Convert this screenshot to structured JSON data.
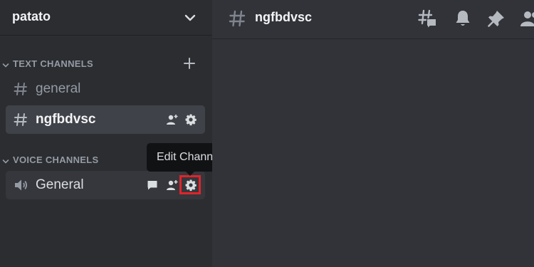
{
  "server": {
    "name": "patato"
  },
  "categories": {
    "text": {
      "label": "TEXT CHANNELS"
    },
    "voice": {
      "label": "VOICE CHANNELS"
    }
  },
  "text_channels": [
    {
      "name": "general"
    },
    {
      "name": "ngfbdvsc"
    }
  ],
  "voice_channels": [
    {
      "name": "General"
    }
  ],
  "tooltip": {
    "text": "Edit Channel"
  },
  "topbar": {
    "channel_name": "ngfbdvsc"
  },
  "colors": {
    "sidebar_bg": "#2b2d31",
    "main_bg": "#313338",
    "selected_bg": "#404249",
    "tooltip_bg": "#111214",
    "highlight": "#e0242a"
  }
}
